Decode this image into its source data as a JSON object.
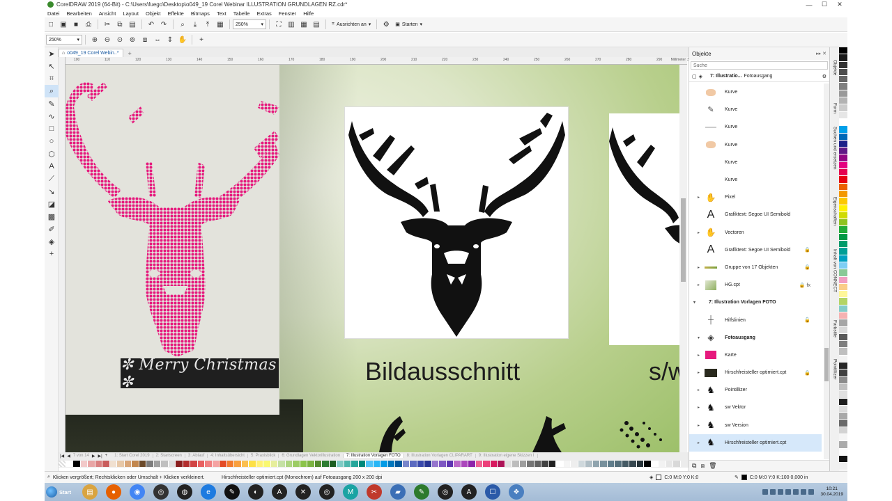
{
  "window": {
    "title": "CorelDRAW 2019 (64-Bit) - C:\\Users\\fuego\\Desktop\\o049_19 Corel Webinar ILLUSTRATION GRUNDLAGEN RZ.cdr*",
    "minimize": "—",
    "maximize": "☐",
    "close": "✕"
  },
  "menu": [
    "Datei",
    "Bearbeiten",
    "Ansicht",
    "Layout",
    "Objekt",
    "Effekte",
    "Bitmaps",
    "Text",
    "Tabelle",
    "Extras",
    "Fenster",
    "Hilfe"
  ],
  "toolbar1": {
    "zoom": "250%",
    "snap_label": "Ausrichten an",
    "launch_label": "Starten"
  },
  "toolbar2": {
    "zoom": "250%"
  },
  "document_tab": {
    "label": "o049_19 Corel Webin..*",
    "add": "+"
  },
  "ruler": {
    "ticks": [
      "100",
      "110",
      "120",
      "130",
      "140",
      "150",
      "160",
      "170",
      "180",
      "190",
      "200",
      "210",
      "220",
      "230",
      "240",
      "250",
      "260",
      "270",
      "280",
      "290",
      "300"
    ],
    "unit": "Millimeter"
  },
  "canvas": {
    "banner_text": "✼ Merry Christmas ✼",
    "caption1": "Bildausschnitt",
    "caption2": "s/w"
  },
  "pagebar": {
    "page_counter": "7 von 14",
    "pages": [
      "1: Start Corel 2019",
      "2: Startscreen",
      "3: Ablauf",
      "4: Inhaltsübersicht",
      "5: Praxisblick",
      "6: Grundlagen Vektorillustration",
      "7: Illustration Vorlagen FOTO",
      "8: Illustration Vorlagen CLIPARART",
      "9: Illustration eigene Skizzen I"
    ],
    "active_index": 6
  },
  "palette_bottom": [
    "#ffffff",
    "#000000",
    "#f2c9c9",
    "#e8a5a5",
    "#d98080",
    "#c95c5c",
    "#f0e0d0",
    "#e7c8a8",
    "#d9a679",
    "#c2874e",
    "#6b4a2a",
    "#7d7d7d",
    "#a0a0a0",
    "#c0c0c0",
    "#e0e0e0",
    "#8a1f1f",
    "#b22f2f",
    "#d14545",
    "#e86060",
    "#f08080",
    "#f5a3a3",
    "#e34c26",
    "#f27c2f",
    "#f9a03f",
    "#fbbf4f",
    "#fde047",
    "#fff176",
    "#f9f871",
    "#e6ee9c",
    "#c5e1a5",
    "#aed581",
    "#9ccc65",
    "#8bc34a",
    "#7cb342",
    "#558b2f",
    "#2e7d32",
    "#1b5e20",
    "#80cbc4",
    "#4db6ac",
    "#26a69a",
    "#00897b",
    "#4fc3f7",
    "#29b6f6",
    "#039be5",
    "#0277bd",
    "#01579b",
    "#7986cb",
    "#5c6bc0",
    "#3949ab",
    "#283593",
    "#9575cd",
    "#7e57c2",
    "#5e35b1",
    "#ba68c8",
    "#ab47bc",
    "#8e24aa",
    "#f06292",
    "#ec407a",
    "#d81b60",
    "#ad1457",
    "#e0e0e0",
    "#bdbdbd",
    "#9e9e9e",
    "#757575",
    "#616161",
    "#424242",
    "#212121",
    "#ffffff",
    "#f5f5f5",
    "#eeeeee",
    "#cfd8dc",
    "#b0bec5",
    "#90a4ae",
    "#78909c",
    "#607d8b",
    "#546e7a",
    "#455a64",
    "#37474f",
    "#263238",
    "#000000",
    "#ffffff",
    "#f2f2f2",
    "#e6e6e6",
    "#d9d9d9"
  ],
  "palette_right": [
    "#000000",
    "#1a1a1a",
    "#333333",
    "#4d4d4d",
    "#666666",
    "#808080",
    "#999999",
    "#b3b3b3",
    "#cccccc",
    "#e6e6e6",
    "#ffffff",
    "#00a0e9",
    "#0068b7",
    "#1d2088",
    "#601986",
    "#920783",
    "#e4007f",
    "#e5004f",
    "#e60012",
    "#eb6100",
    "#f39800",
    "#fcc800",
    "#fff100",
    "#cfdb00",
    "#8fc31f",
    "#22ac38",
    "#009944",
    "#009b6b",
    "#009e96",
    "#00a0c1",
    "#7ecef4",
    "#89c997",
    "#f19ec2",
    "#facd89",
    "#fff799",
    "#b3d465",
    "#84ccc9",
    "#f5b2b2",
    "#a6a6a6",
    "#d9d9d9",
    "#595959",
    "#7f7f7f",
    "#bfbfbf",
    "#f2f2f2",
    "#262626",
    "#404040",
    "#8c8c8c",
    "#c0c0c0",
    "#e0e0e0",
    "#1e1e1e",
    "#dcdcdc",
    "#a9a9a9",
    "#696969",
    "#d3d3d3",
    "#f5f5f5",
    "#ababab",
    "#fafafa",
    "#121212",
    "#efefef"
  ],
  "objects_panel": {
    "title": "Objekte",
    "search_placeholder": "Suche",
    "current_layer": "7: Illustratio...",
    "current_object": "Fotoausgang",
    "rows": [
      {
        "label": "Kurve",
        "thumb": "peach",
        "arrow": "",
        "lock": ""
      },
      {
        "label": "Kurve",
        "thumb": "sketch",
        "arrow": "",
        "lock": ""
      },
      {
        "label": "Kurve",
        "thumb": "line",
        "arrow": "",
        "lock": ""
      },
      {
        "label": "Kurve",
        "thumb": "peach",
        "arrow": "",
        "lock": ""
      },
      {
        "label": "Kurve",
        "thumb": "",
        "arrow": "",
        "lock": ""
      },
      {
        "label": "Kurve",
        "thumb": "",
        "arrow": "",
        "lock": ""
      },
      {
        "label": "Pixel",
        "thumb": "hand",
        "arrow": "▸",
        "lock": ""
      },
      {
        "label": "Grafiktext: Segoe UI Semibold",
        "thumb": "A",
        "arrow": "",
        "lock": ""
      },
      {
        "label": "Vectoren",
        "thumb": "hand",
        "arrow": "▸",
        "lock": ""
      },
      {
        "label": "Grafiktext: Segoe UI Semibold",
        "thumb": "A",
        "arrow": "",
        "lock": "🔒"
      },
      {
        "label": "Gruppe von 17 Objekten",
        "thumb": "bar",
        "arrow": "▸",
        "lock": "🔒"
      },
      {
        "label": "HG.cpt",
        "thumb": "green",
        "arrow": "▸",
        "lock": "🔒 fx"
      }
    ],
    "layer_label": "7: Illustration Vorlagen FOTO",
    "layer_rows": [
      {
        "label": "Hilfslinien",
        "thumb": "guides",
        "arrow": "",
        "lock": "🔓"
      },
      {
        "label": "Fotoausgang",
        "thumb": "layers",
        "arrow": "▾",
        "lock": "",
        "bold": true
      }
    ],
    "sub_rows": [
      {
        "label": "Karte",
        "thumb": "pink",
        "arrow": "▸",
        "lock": ""
      },
      {
        "label": "Hirschfreisteller optimiert.cpt",
        "thumb": "dark",
        "arrow": "▸",
        "lock": "🔒"
      },
      {
        "label": "Pointillizer",
        "thumb": "deer",
        "arrow": "▸",
        "lock": ""
      },
      {
        "label": "sw Vektor",
        "thumb": "deer",
        "arrow": "▸",
        "lock": ""
      },
      {
        "label": "sw Version",
        "thumb": "deer",
        "arrow": "▸",
        "lock": ""
      },
      {
        "label": "Hirschfreisteller optimiert.cpt",
        "thumb": "deer",
        "arrow": "▸",
        "lock": "",
        "selected": true
      }
    ]
  },
  "docker_tabs": [
    "Objekte",
    "Form",
    "Suchen und ersetzen",
    "Eigenschaften",
    "Inhalt von CONNECT",
    "Farbstile",
    "Pointillizer"
  ],
  "status": {
    "hint": "Klicken vergrößert; Rechtsklicken oder Umschalt + Klicken verkleinert.",
    "object_info": "Hirschfreisteller optimiert.cpt (Monochrom) auf Fotoausgang 200 x 200 dpi",
    "fill_info": "C:0 M:0 Y:0 K:0",
    "outline_info": "C:0 M:0 Y:0 K:100  0,000 in"
  },
  "taskbar": {
    "start": "Start",
    "apps": [
      {
        "name": "explorer-icon",
        "color": "#d9a441",
        "glyph": "▤"
      },
      {
        "name": "firefox-icon",
        "color": "#e66000",
        "glyph": "●"
      },
      {
        "name": "chrome-icon",
        "color": "#4285f4",
        "glyph": "◉"
      },
      {
        "name": "obs-icon",
        "color": "#333333",
        "glyph": "◎"
      },
      {
        "name": "app-icon",
        "color": "#222222",
        "glyph": "◍"
      },
      {
        "name": "edge-icon",
        "color": "#1e7be0",
        "glyph": "e"
      },
      {
        "name": "app2-icon",
        "color": "#111111",
        "glyph": "✎"
      },
      {
        "name": "app3-icon",
        "color": "#222222",
        "glyph": "◐"
      },
      {
        "name": "app4-icon",
        "color": "#222222",
        "glyph": "A"
      },
      {
        "name": "app5-icon",
        "color": "#222222",
        "glyph": "✕"
      },
      {
        "name": "app6-icon",
        "color": "#222222",
        "glyph": "◎"
      },
      {
        "name": "app7-icon",
        "color": "#1aa3a3",
        "glyph": "M"
      },
      {
        "name": "app8-icon",
        "color": "#c0392b",
        "glyph": "✂"
      },
      {
        "name": "app9-icon",
        "color": "#3b6fb6",
        "glyph": "▰"
      },
      {
        "name": "coreldraw-icon",
        "color": "#2d7a2d",
        "glyph": "✎"
      },
      {
        "name": "app10-icon",
        "color": "#222222",
        "glyph": "◎"
      },
      {
        "name": "app11-icon",
        "color": "#222222",
        "glyph": "A"
      },
      {
        "name": "app12-icon",
        "color": "#2b5aa8",
        "glyph": "☐"
      },
      {
        "name": "app13-icon",
        "color": "#4a7fc0",
        "glyph": "❖"
      }
    ],
    "time": "10:21",
    "date": "30.04.2019"
  }
}
